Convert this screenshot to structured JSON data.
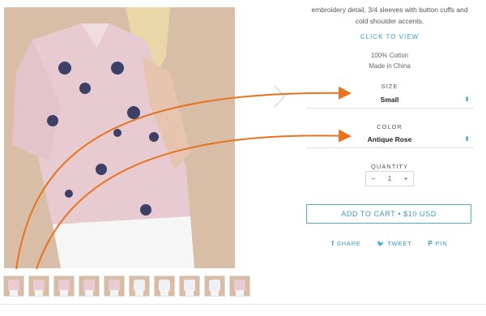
{
  "description": {
    "line1": "embroidery detail, 3/4 sleeves with button cuffs and",
    "line2": "cold shoulder accents."
  },
  "click_to_view": "CLICK TO VIEW",
  "material": {
    "fabric": "100% Cotton",
    "origin": "Made in China"
  },
  "size": {
    "label": "SIZE",
    "value": "Small"
  },
  "color": {
    "label": "COLOR",
    "value": "Antique Rose"
  },
  "quantity": {
    "label": "QUANTITY",
    "minus": "–",
    "value": "1",
    "plus": "+"
  },
  "add_to_cart": "ADD TO CART • $10 USD",
  "share": {
    "share_label": "SHARE",
    "share_icon": "f",
    "tweet_label": "TWEET",
    "tweet_icon": "🐦",
    "pin_label": "PIN",
    "pin_icon": "P"
  },
  "thumbnails_count": 10,
  "colors": {
    "accent": "#3a9bc8",
    "arrow": "#e8731f"
  }
}
